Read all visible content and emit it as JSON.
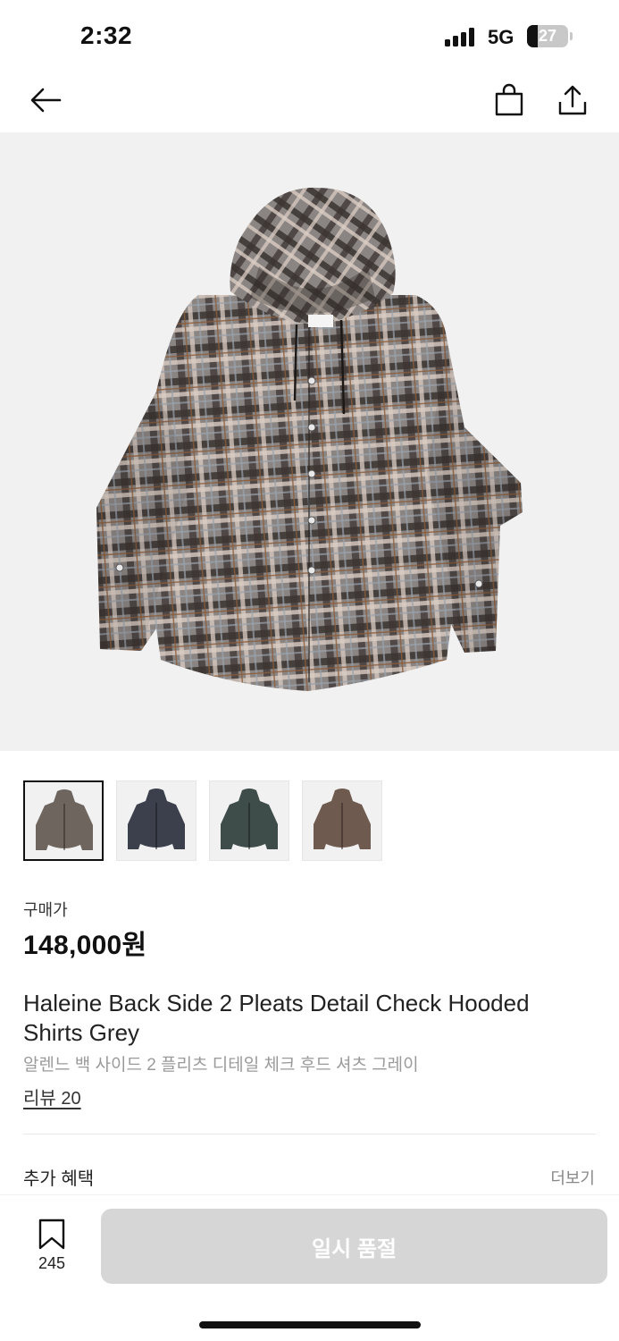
{
  "status_bar": {
    "time": "2:32",
    "network": "5G",
    "battery": "27",
    "battery_level": 0.27
  },
  "nav": {
    "back_icon": "arrow-left-icon",
    "cart_icon": "shopping-bag-icon",
    "share_icon": "share-icon"
  },
  "gallery": {
    "main_image": "plaid-hooded-shirt-grey",
    "thumbnails": [
      {
        "name": "grey",
        "color": "#6e655f",
        "selected": true
      },
      {
        "name": "navy",
        "color": "#3c3f4c",
        "selected": false
      },
      {
        "name": "green",
        "color": "#3e4c4a",
        "selected": false
      },
      {
        "name": "brown",
        "color": "#6f5a50",
        "selected": false
      }
    ]
  },
  "product": {
    "price_label": "구매가",
    "price": "148,000원",
    "title": "Haleine Back Side 2 Pleats Detail Check Hooded Shirts Grey",
    "subtitle": "알렌느 백 사이드 2 플리츠 디테일 체크 후드 셔츠 그레이",
    "review_link": "리뷰 20"
  },
  "benefits": {
    "title": "추가 혜택",
    "more": "더보기"
  },
  "bottom_bar": {
    "bookmark_icon": "bookmark-icon",
    "bookmark_count": "245",
    "buy_button": "일시 품절"
  },
  "colors": {
    "soldout_button": "#d6d6d6",
    "image_background": "#f1f1f1"
  }
}
